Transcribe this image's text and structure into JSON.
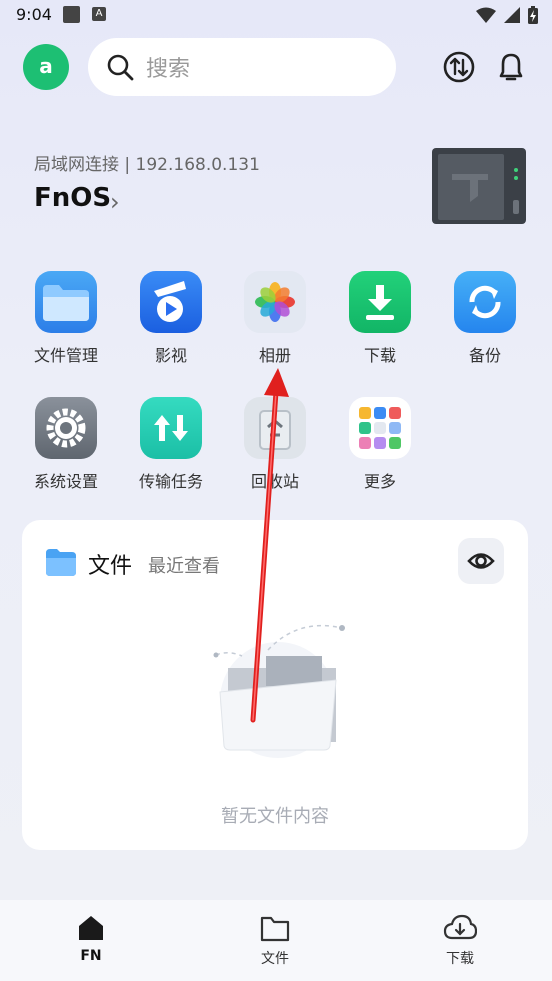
{
  "status_bar": {
    "time": "9:04"
  },
  "header": {
    "avatar_letter": "a",
    "search_placeholder": "搜索"
  },
  "device": {
    "connection": "局域网连接 | 192.168.0.131",
    "name": "FnOS"
  },
  "apps": [
    {
      "label": "文件管理",
      "icon": "folder-icon"
    },
    {
      "label": "影视",
      "icon": "video-icon"
    },
    {
      "label": "相册",
      "icon": "photos-icon"
    },
    {
      "label": "下载",
      "icon": "download-icon"
    },
    {
      "label": "备份",
      "icon": "backup-icon"
    },
    {
      "label": "系统设置",
      "icon": "settings-icon"
    },
    {
      "label": "传输任务",
      "icon": "transfer-icon"
    },
    {
      "label": "回收站",
      "icon": "recycle-bin-icon"
    },
    {
      "label": "更多",
      "icon": "more-apps-icon"
    }
  ],
  "files_card": {
    "title": "文件",
    "subtitle": "最近查看",
    "empty_text": "暂无文件内容"
  },
  "bottom_nav": [
    {
      "label": "FN",
      "icon": "home-icon",
      "active": true
    },
    {
      "label": "文件",
      "icon": "folder-outline-icon",
      "active": false
    },
    {
      "label": "下载",
      "icon": "cloud-download-icon",
      "active": false
    }
  ],
  "colors": {
    "accent_green": "#1dbf73",
    "annotation_arrow": "#e0201e"
  }
}
